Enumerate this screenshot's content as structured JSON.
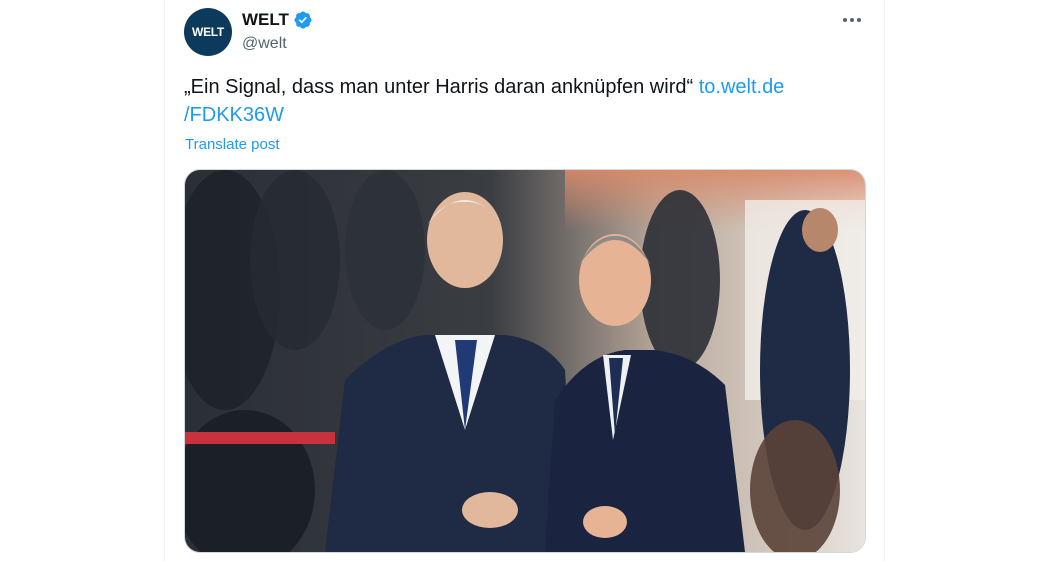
{
  "post": {
    "avatar_text": "WELT",
    "display_name": "WELT",
    "handle": "@welt",
    "text": "„Ein Signal, dass man unter Harris daran anknüpfen wird“ ",
    "link_part1": "to.welt.de",
    "link_part2": "/FDKK36W",
    "translate_label": "Translate post"
  },
  "colors": {
    "link": "#1d9bf0",
    "verified_badge": "#1d9bf0",
    "avatar_bg": "#0b3a5c"
  },
  "icons": {
    "verified": "verified-badge-icon",
    "more": "more-dots-icon"
  }
}
